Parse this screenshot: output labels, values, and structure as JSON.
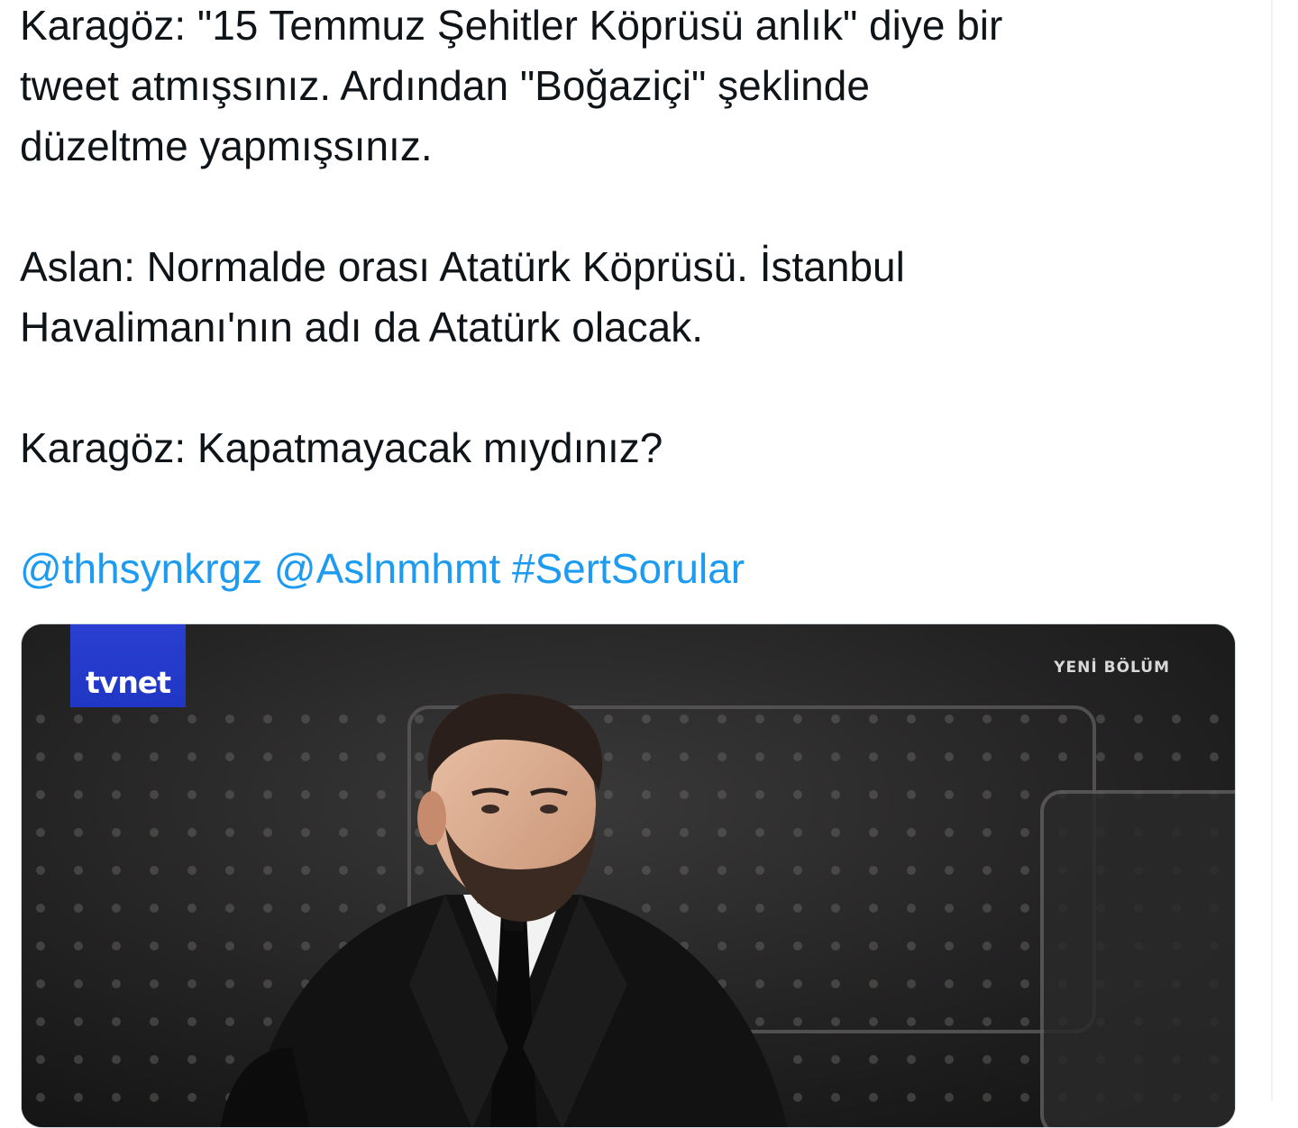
{
  "tweet": {
    "paragraphs": [
      "Karagöz: \"15 Temmuz Şehitler Köprüsü anlık\" diye bir\ntweet atmışsınız. Ardından \"Boğaziçi\" şeklinde\ndüzeltme yapmışsınız.",
      "Aslan: Normalde orası Atatürk Köprüsü. İstanbul\nHavalimanı'nın adı da Atatürk olacak.",
      "Karagöz: Kapatmayacak mıydınız?"
    ],
    "mentions": [
      "@thhsynkrgz",
      "@Aslnmhmt"
    ],
    "hashtag": "#SertSorular"
  },
  "media": {
    "logo_text": "tvnet",
    "badge_text": "YENİ BÖLÜM"
  },
  "colors": {
    "text": "#0f1419",
    "link": "#1d9bf0",
    "logo_bg": "#2036c4",
    "studio_bg": "#1b1b1c"
  }
}
